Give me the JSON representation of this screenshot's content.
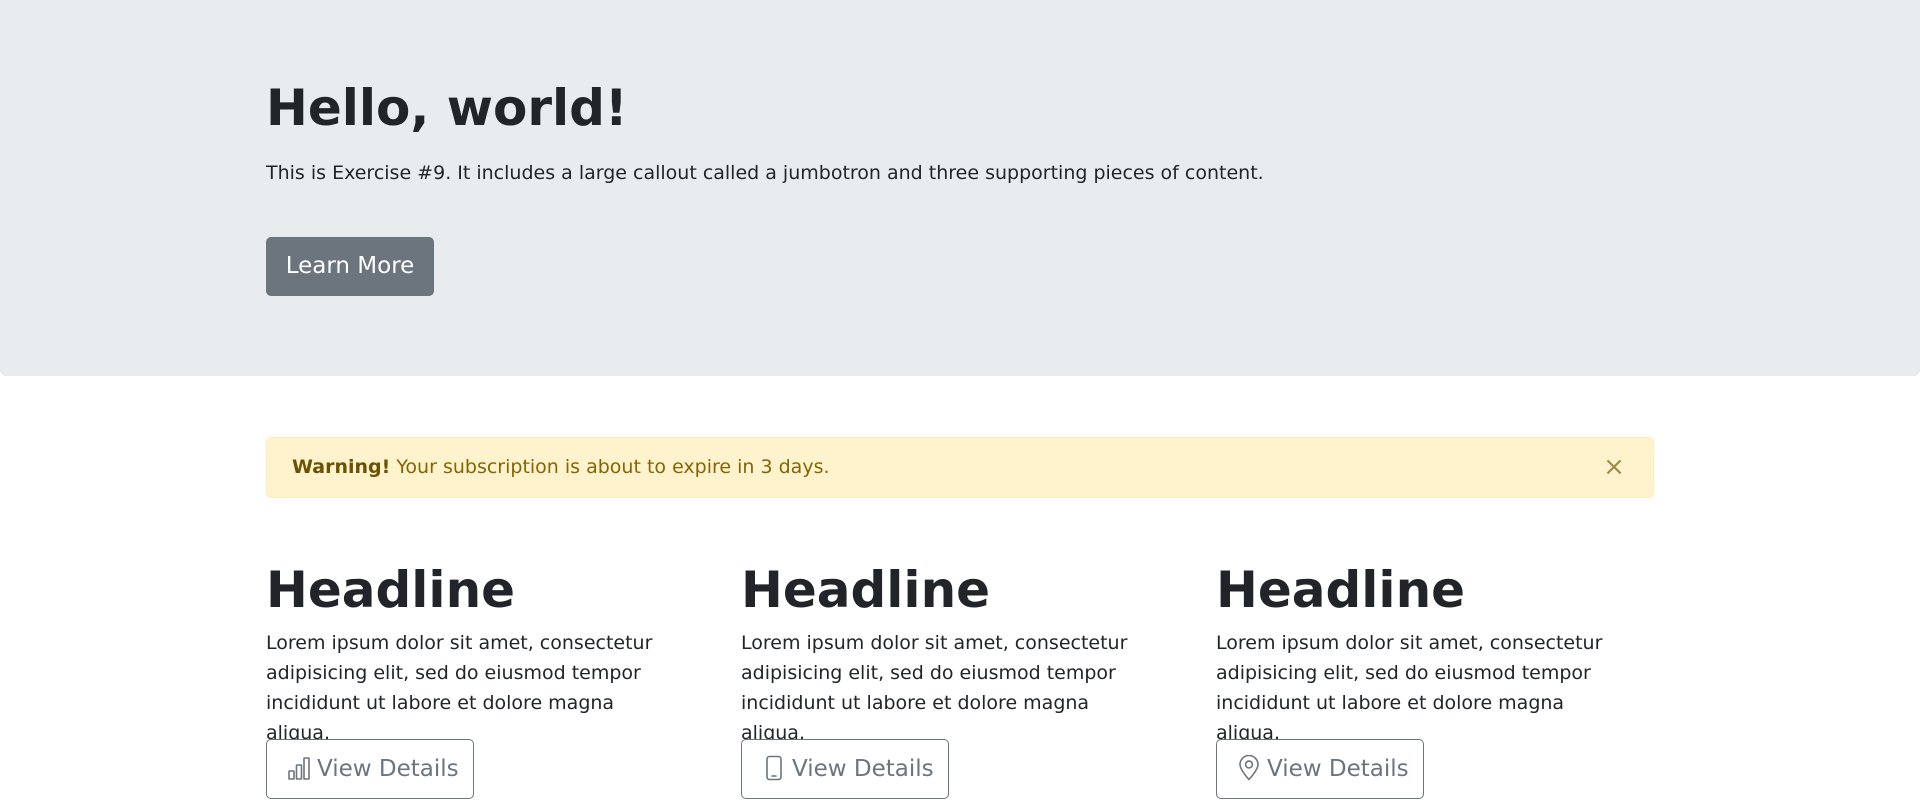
{
  "jumbotron": {
    "title": "Hello, world!",
    "lead": "This is Exercise #9. It includes a large callout called a jumbotron and three supporting pieces of content.",
    "button_label": "Learn More"
  },
  "alert": {
    "strong": "Warning!",
    "message": " Your subscription is about to expire in 3 days.",
    "close_symbol": "×",
    "colors": {
      "background": "#fff3cd",
      "text": "#856404"
    }
  },
  "columns": [
    {
      "headline": "Headline",
      "body": "Lorem ipsum dolor sit amet, consectetur adipisicing elit, sed do eiusmod tempor incididunt ut labore et dolore magna aliqua.",
      "button_label": "View Details",
      "icon": "bar-chart-icon"
    },
    {
      "headline": "Headline",
      "body": "Lorem ipsum dolor sit amet, consectetur adipisicing elit, sed do eiusmod tempor incididunt ut labore et dolore magna aliqua.",
      "button_label": "View Details",
      "icon": "phone-icon"
    },
    {
      "headline": "Headline",
      "body": "Lorem ipsum dolor sit amet, consectetur adipisicing elit, sed do eiusmod tempor incididunt ut labore et dolore magna aliqua.",
      "button_label": "View Details",
      "icon": "map-pin-icon"
    }
  ],
  "colors": {
    "jumbotron_bg": "#e9ecef",
    "secondary": "#6c757d",
    "text": "#212529"
  }
}
